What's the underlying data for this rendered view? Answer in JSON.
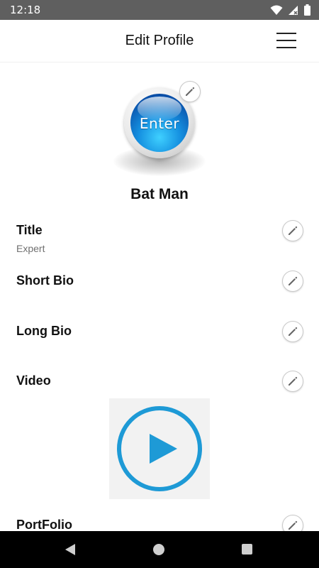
{
  "status_bar": {
    "time": "12:18"
  },
  "header": {
    "title": "Edit Profile"
  },
  "profile": {
    "avatar_text": "Enter",
    "name": "Bat Man"
  },
  "fields": {
    "title": {
      "label": "Title",
      "value": "Expert"
    },
    "short_bio": {
      "label": "Short Bio"
    },
    "long_bio": {
      "label": "Long Bio"
    },
    "video": {
      "label": "Video"
    },
    "portfolio": {
      "label": "PortFolio"
    }
  },
  "colors": {
    "accent": "#1e9ad6",
    "status_bar": "#5f5f5f",
    "nav_bar": "#000000"
  },
  "icons": [
    "wifi-icon",
    "signal-icon",
    "battery-icon",
    "menu-icon",
    "pencil-icon",
    "play-icon",
    "back-icon",
    "home-icon",
    "recents-icon"
  ]
}
